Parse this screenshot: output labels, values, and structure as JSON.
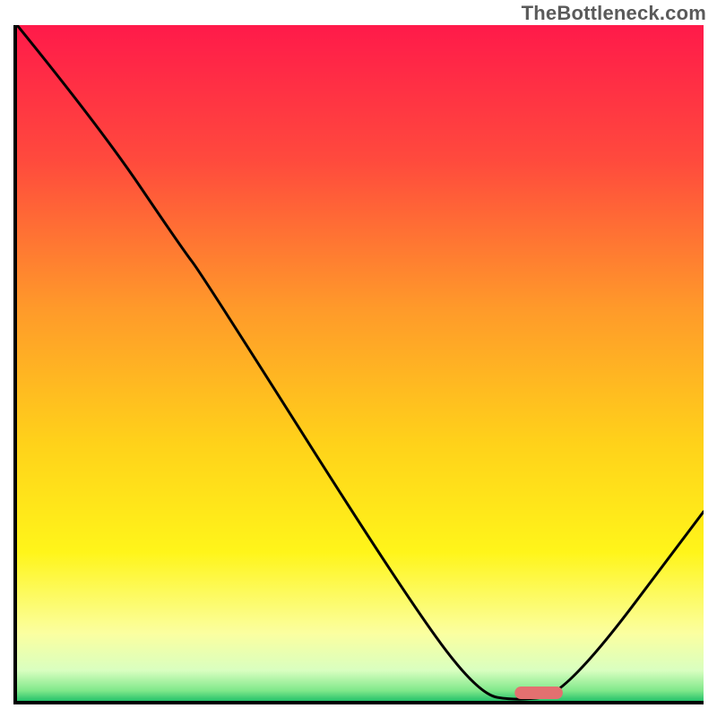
{
  "watermark": "TheBottleneck.com",
  "chart_data": {
    "type": "line",
    "title": "",
    "xlabel": "",
    "ylabel": "",
    "x_range": [
      0,
      100
    ],
    "y_range": [
      0,
      100
    ],
    "series": [
      {
        "name": "bottleneck-curve",
        "x": [
          0,
          12,
          24,
          27,
          55,
          67,
          73,
          80,
          100
        ],
        "y": [
          100,
          85,
          67,
          63,
          18,
          1,
          0,
          1,
          28
        ]
      }
    ],
    "marker": {
      "name": "optimal-marker",
      "x_center": 76,
      "width_pct": 7,
      "color": "#e37070"
    },
    "background": {
      "type": "vertical-gradient",
      "zones": [
        {
          "stop": 0.0,
          "color": "#ff1a4a"
        },
        {
          "stop": 0.2,
          "color": "#ff4a3d"
        },
        {
          "stop": 0.42,
          "color": "#ff9a2a"
        },
        {
          "stop": 0.62,
          "color": "#ffd21a"
        },
        {
          "stop": 0.78,
          "color": "#fff51a"
        },
        {
          "stop": 0.9,
          "color": "#fbffa0"
        },
        {
          "stop": 0.955,
          "color": "#d9ffc0"
        },
        {
          "stop": 0.985,
          "color": "#7fe88a"
        },
        {
          "stop": 1.0,
          "color": "#25c16a"
        }
      ]
    }
  }
}
